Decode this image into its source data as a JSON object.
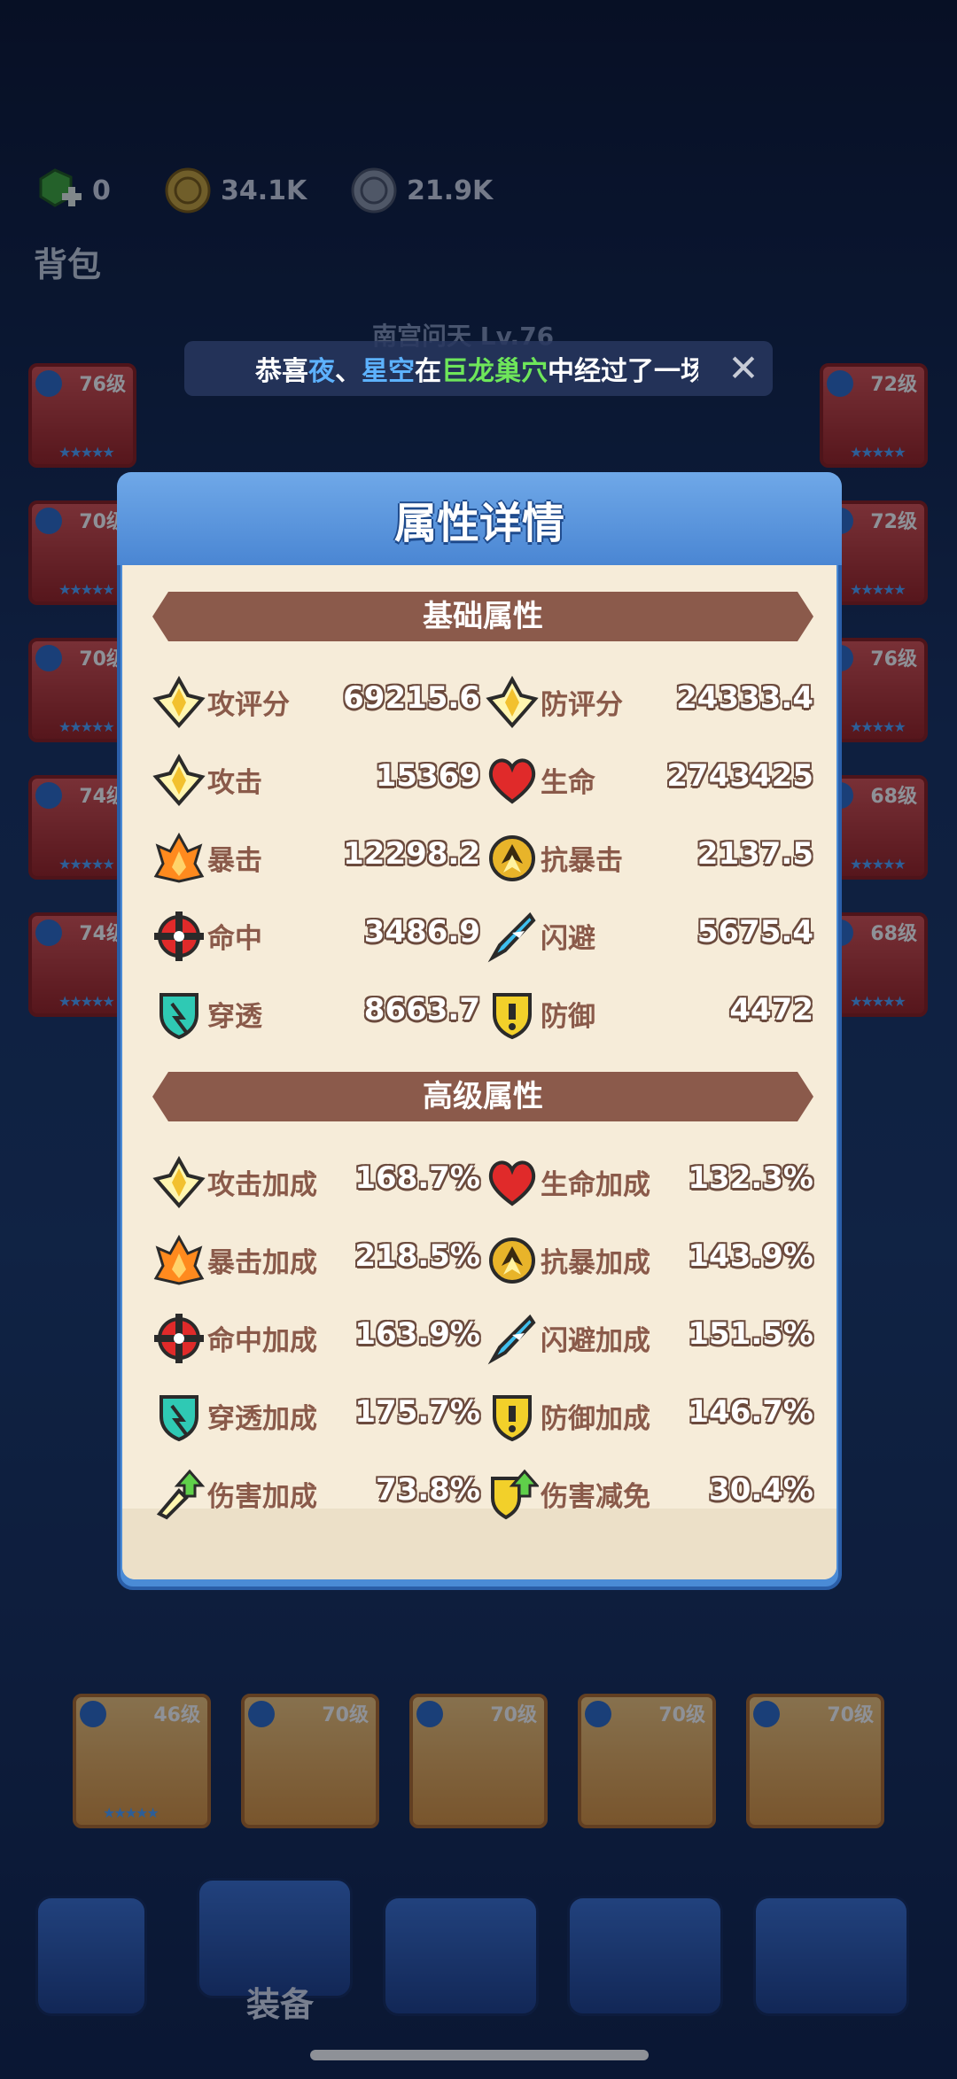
{
  "currency": [
    {
      "icon": "green-gem-plus-icon",
      "value": "0"
    },
    {
      "icon": "gold-coin-icon",
      "value": "34.1K"
    },
    {
      "icon": "silver-coin-icon",
      "value": "21.9K"
    }
  ],
  "bag_title": "背包",
  "hero_name": "南宫问天 Lv.76",
  "announcement": {
    "prefix": "恭喜",
    "player_a": "夜",
    "separator": "、",
    "player_b": "星空",
    "middle": "在",
    "location": "巨龙巢穴",
    "suffix": "中经过了一场",
    "close_icon": "close-icon"
  },
  "equipment_left": [
    {
      "level": "76级"
    },
    {
      "level": "70级"
    },
    {
      "level": "70级"
    },
    {
      "level": "74级"
    },
    {
      "level": "74级"
    }
  ],
  "equipment_right": [
    {
      "level": "72级"
    },
    {
      "level": "72级"
    },
    {
      "level": "76级"
    },
    {
      "level": "68级"
    },
    {
      "level": "68级"
    }
  ],
  "equipment_bottom": [
    {
      "level": "46级"
    },
    {
      "level": "70级"
    },
    {
      "level": "70级"
    },
    {
      "level": "70级"
    },
    {
      "level": "70级"
    }
  ],
  "nav_label": "装备",
  "modal": {
    "title": "属性详情",
    "basic_header": "基础属性",
    "advanced_header": "高级属性",
    "basic": [
      {
        "icon": "attack-rating-icon",
        "label": "攻评分",
        "value": "69215.6"
      },
      {
        "icon": "defense-rating-icon",
        "label": "防评分",
        "value": "24333.4"
      },
      {
        "icon": "attack-icon",
        "label": "攻击",
        "value": "15369"
      },
      {
        "icon": "heart-icon",
        "label": "生命",
        "value": "2743425"
      },
      {
        "icon": "crit-flame-icon",
        "label": "暴击",
        "value": "12298.2"
      },
      {
        "icon": "anti-crit-icon",
        "label": "抗暴击",
        "value": "2137.5"
      },
      {
        "icon": "crosshair-icon",
        "label": "命中",
        "value": "3486.9"
      },
      {
        "icon": "dodge-feather-icon",
        "label": "闪避",
        "value": "5675.4"
      },
      {
        "icon": "pierce-shield-icon",
        "label": "穿透",
        "value": "8663.7"
      },
      {
        "icon": "defense-shield-icon",
        "label": "防御",
        "value": "4472"
      }
    ],
    "advanced": [
      {
        "icon": "attack-icon",
        "label": "攻击加成",
        "value": "168.7%"
      },
      {
        "icon": "heart-icon",
        "label": "生命加成",
        "value": "132.3%"
      },
      {
        "icon": "crit-flame-icon",
        "label": "暴击加成",
        "value": "218.5%"
      },
      {
        "icon": "anti-crit-icon",
        "label": "抗暴加成",
        "value": "143.9%"
      },
      {
        "icon": "crosshair-icon",
        "label": "命中加成",
        "value": "163.9%"
      },
      {
        "icon": "dodge-feather-icon",
        "label": "闪避加成",
        "value": "151.5%"
      },
      {
        "icon": "pierce-shield-icon",
        "label": "穿透加成",
        "value": "175.7%"
      },
      {
        "icon": "defense-shield-icon",
        "label": "防御加成",
        "value": "146.7%"
      },
      {
        "icon": "damage-up-icon",
        "label": "伤害加成",
        "value": "73.8%"
      },
      {
        "icon": "damage-reduce-icon",
        "label": "伤害减免",
        "value": "30.4%"
      }
    ]
  }
}
